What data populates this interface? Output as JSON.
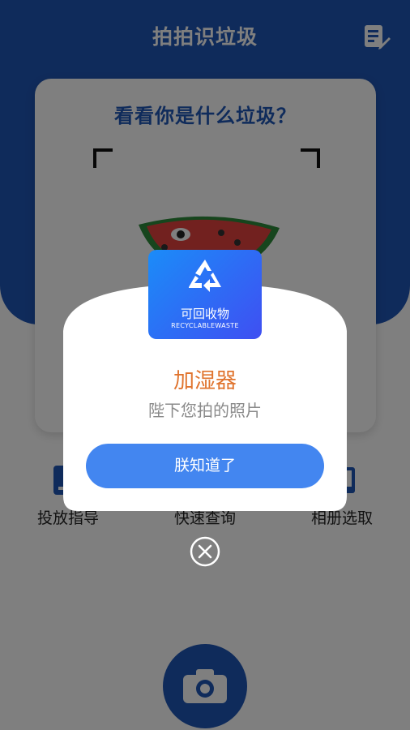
{
  "header": {
    "title": "拍拍识垃圾",
    "edit_icon": "edit-note-icon"
  },
  "scanner": {
    "prompt": "看看你是什么垃圾？"
  },
  "tools": [
    {
      "label": "投放指导",
      "icon": "guide-icon"
    },
    {
      "label": "快速查询",
      "icon": "search-icon"
    },
    {
      "label": "相册选取",
      "icon": "album-icon"
    }
  ],
  "camera": {
    "icon": "camera-icon"
  },
  "dialog": {
    "category": "可回收物",
    "category_en": "RECYCLABLEWASTE",
    "item_name": "加湿器",
    "subtitle": "陛下您拍的照片",
    "ok_label": "朕知道了",
    "close_icon": "close-circle-icon"
  },
  "colors": {
    "primary": "#1f56b6",
    "button": "#4386f0",
    "result_text": "#e0742e",
    "badge_gradient_start": "#1b8cf8",
    "badge_gradient_end": "#3f4ff2"
  }
}
